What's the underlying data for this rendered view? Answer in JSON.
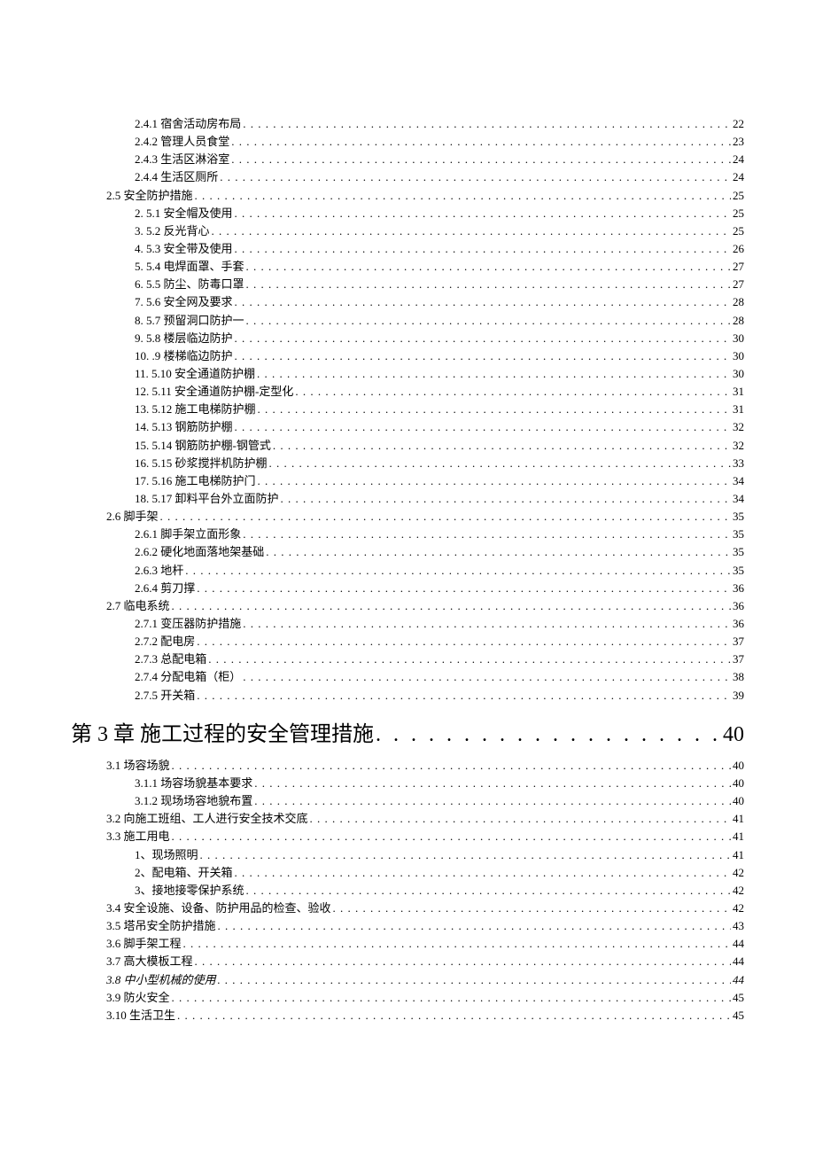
{
  "toc": [
    {
      "indent": 2,
      "label": "2.4.1   宿舍活动房布局",
      "page": "22",
      "chapter": false
    },
    {
      "indent": 2,
      "label": "2.4.2   管理人员食堂",
      "page": "23",
      "chapter": false
    },
    {
      "indent": 2,
      "label": "2.4.3   生活区淋浴室",
      "page": "24",
      "chapter": false
    },
    {
      "indent": 2,
      "label": "2.4.4   生活区厕所",
      "page": "24",
      "chapter": false
    },
    {
      "indent": 1,
      "label": "2.5 安全防护措施",
      "page": "25",
      "chapter": false
    },
    {
      "indent": 2,
      "label": "2.   5.1 安全帽及使用",
      "page": "25",
      "chapter": false
    },
    {
      "indent": 2,
      "label": "3.   5.2 反光背心",
      "page": "25",
      "chapter": false
    },
    {
      "indent": 2,
      "label": "4.   5.3 安全带及使用",
      "page": "26",
      "chapter": false
    },
    {
      "indent": 2,
      "label": "5.   5.4 电焊面罩、手套",
      "page": "27",
      "chapter": false
    },
    {
      "indent": 2,
      "label": "6.   5.5 防尘、防毒口罩",
      "page": "27",
      "chapter": false
    },
    {
      "indent": 2,
      "label": "7.   5.6 安全网及要求",
      "page": "28",
      "chapter": false
    },
    {
      "indent": 2,
      "label": "8.   5.7 预留洞口防护一",
      "page": "28",
      "chapter": false
    },
    {
      "indent": 2,
      "label": "9.   5.8 楼层临边防护",
      "page": "30",
      "chapter": false
    },
    {
      "indent": 2,
      "label": "10.   .9 楼梯临边防护",
      "page": "30",
      "chapter": false
    },
    {
      "indent": 2,
      "label": "11. 5.10 安全通道防护棚",
      "page": "30",
      "chapter": false
    },
    {
      "indent": 2,
      "label": "12. 5.11 安全通道防护棚-定型化",
      "page": "31",
      "chapter": false
    },
    {
      "indent": 2,
      "label": "13. 5.12 施工电梯防护棚",
      "page": "31",
      "chapter": false
    },
    {
      "indent": 2,
      "label": "14. 5.13 钢筋防护棚",
      "page": "32",
      "chapter": false
    },
    {
      "indent": 2,
      "label": "15. 5.14 钢筋防护棚-钢管式",
      "page": "32",
      "chapter": false
    },
    {
      "indent": 2,
      "label": "16. 5.15 砂浆搅拌机防护棚",
      "page": "33",
      "chapter": false
    },
    {
      "indent": 2,
      "label": "17. 5.16 施工电梯防护门",
      "page": "34",
      "chapter": false
    },
    {
      "indent": 2,
      "label": "18. 5.17 卸料平台外立面防护",
      "page": "34",
      "chapter": false
    },
    {
      "indent": 1,
      "label": "2.6   脚手架",
      "page": "35",
      "chapter": false
    },
    {
      "indent": 2,
      "label": "2.6.1   脚手架立面形象",
      "page": "35",
      "chapter": false
    },
    {
      "indent": 2,
      "label": "2.6.2   硬化地面落地架基础",
      "page": "35",
      "chapter": false
    },
    {
      "indent": 2,
      "label": "2.6.3      地杆",
      "page": "35",
      "chapter": false
    },
    {
      "indent": 2,
      "label": "2.6.4   剪刀撑",
      "page": "36",
      "chapter": false
    },
    {
      "indent": 1,
      "label": "2.7   临电系统",
      "page": "36",
      "chapter": false
    },
    {
      "indent": 2,
      "label": "2.7.1   变压器防护措施",
      "page": "36",
      "chapter": false
    },
    {
      "indent": 2,
      "label": "2.7.2   配电房",
      "page": "37",
      "chapter": false
    },
    {
      "indent": 2,
      "label": "2.7.3   总配电箱",
      "page": "37",
      "chapter": false
    },
    {
      "indent": 2,
      "label": "2.7.4   分配电箱（柜）",
      "page": "38",
      "chapter": false
    },
    {
      "indent": 2,
      "label": "2.7.5   开关箱",
      "page": "39",
      "chapter": false
    },
    {
      "indent": 0,
      "label": "第 3 章 施工过程的安全管理措施",
      "page": "40",
      "chapter": true
    },
    {
      "indent": 1,
      "label": "3.1   场容场貌",
      "page": "40",
      "chapter": false
    },
    {
      "indent": 2,
      "label": "3.1.1   场容场貌基本要求",
      "page": "40",
      "chapter": false
    },
    {
      "indent": 2,
      "label": "3.1.2   现场场容地貌布置",
      "page": "40",
      "chapter": false
    },
    {
      "indent": 1,
      "label": "3.2   向施工班组、工人进行安全技术交底",
      "page": "41",
      "chapter": false
    },
    {
      "indent": 1,
      "label": "3.3   施工用电",
      "page": "41",
      "chapter": false
    },
    {
      "indent": 2,
      "label": "1、现场照明",
      "page": "41",
      "chapter": false
    },
    {
      "indent": 2,
      "label": "2、配电箱、开关箱",
      "page": "42",
      "chapter": false
    },
    {
      "indent": 2,
      "label": "3、接地接零保护系统",
      "page": "42",
      "chapter": false
    },
    {
      "indent": 1,
      "label": "3.4   安全设施、设备、防护用品的检查、验收",
      "page": "42",
      "chapter": false
    },
    {
      "indent": 1,
      "label": "3.5   塔吊安全防护措施",
      "page": "43",
      "chapter": false
    },
    {
      "indent": 1,
      "label": "3.6   脚手架工程",
      "page": "44",
      "chapter": false
    },
    {
      "indent": 1,
      "label": "3.7   高大模板工程",
      "page": "44",
      "chapter": false
    },
    {
      "indent": 1,
      "label": "3.8   中小型机械的使用",
      "page": "44",
      "chapter": false,
      "italic": true
    },
    {
      "indent": 1,
      "label": "3.9   防火安全",
      "page": "45",
      "chapter": false
    },
    {
      "indent": 1,
      "label": "3.10   生活卫生",
      "page": "45",
      "chapter": false
    }
  ]
}
